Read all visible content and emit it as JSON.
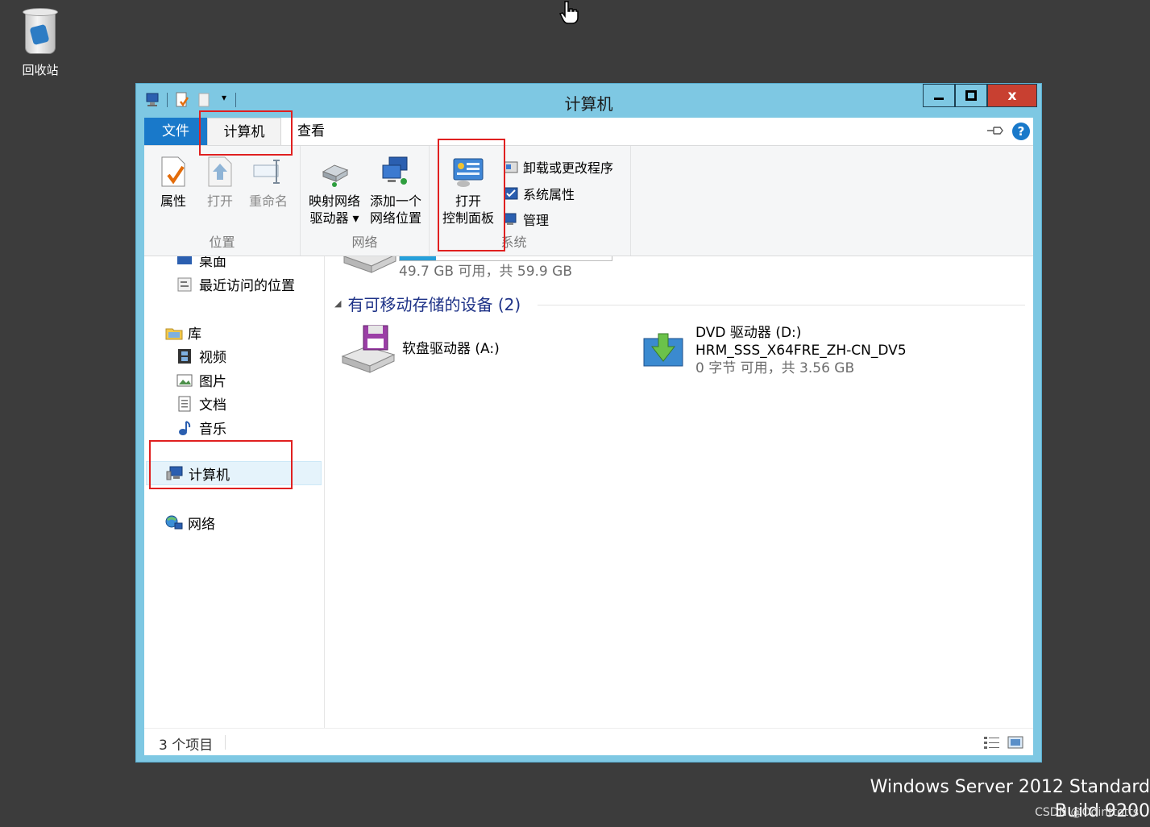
{
  "desktop": {
    "recycle_bin_label": "回收站",
    "watermark_line1": "Windows Server 2012 Standard",
    "watermark_line2": "Build 9200",
    "csdn": "CSDN @Odinttotts"
  },
  "window": {
    "title": "计算机",
    "controls": {
      "minimize": "▁",
      "maximize": "□",
      "close": "x"
    }
  },
  "ribbon_tabs": {
    "file": "文件",
    "computer": "计算机",
    "view": "查看"
  },
  "ribbon": {
    "location": {
      "label": "位置",
      "properties": "属性",
      "open": "打开",
      "rename": "重命名"
    },
    "network": {
      "label": "网络",
      "map_drive_line1": "映射网络",
      "map_drive_line2": "驱动器 ▾",
      "add_location_line1": "添加一个",
      "add_location_line2": "网络位置"
    },
    "system": {
      "label": "系统",
      "open_cp_line1": "打开",
      "open_cp_line2": "控制面板",
      "uninstall": "卸载或更改程序",
      "sys_props": "系统属性",
      "manage": "管理"
    }
  },
  "nav": {
    "desktop": "桌面",
    "recent": "最近访问的位置",
    "libraries": "库",
    "videos": "视频",
    "pictures": "图片",
    "documents": "文档",
    "music": "音乐",
    "computer": "计算机",
    "network": "网络"
  },
  "main": {
    "c_drive_space": "49.7 GB 可用，共 59.9 GB",
    "removable_header": "有可移动存储的设备 (2)",
    "floppy": "软盘驱动器 (A:)",
    "dvd_name": "DVD 驱动器 (D:)",
    "dvd_label": "HRM_SSS_X64FRE_ZH-CN_DV5",
    "dvd_space": "0 字节 可用，共 3.56 GB"
  },
  "status": {
    "items": "3 个项目"
  },
  "colors": {
    "titlebar": "#7ec8e3",
    "file_tab": "#1979ca",
    "close": "#c84031",
    "highlight": "#e02020"
  }
}
